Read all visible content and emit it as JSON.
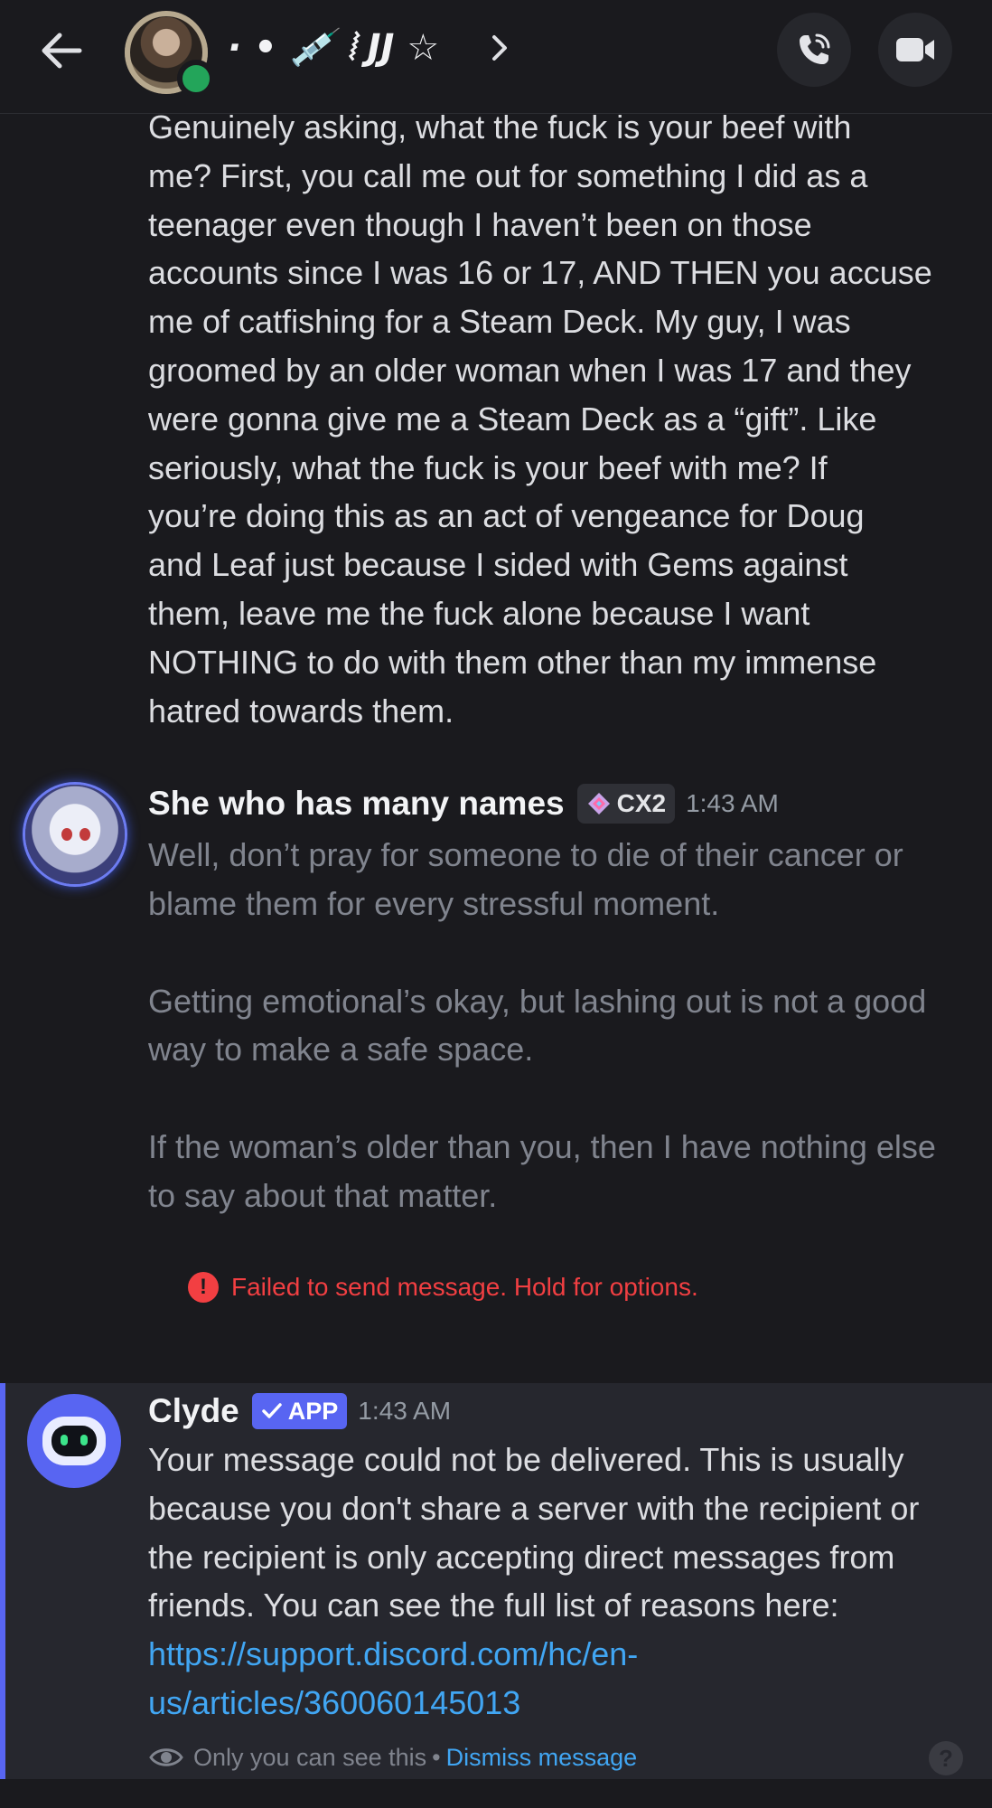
{
  "header": {
    "title": "· • 💉 ⦚ JJ ☆",
    "online": true
  },
  "messages": [
    {
      "body": "Genuinely asking, what the fuck is your beef with\nme? First, you call me out for something I did as a\nteenager even though I haven’t been on those\naccounts since I was 16 or 17, AND THEN you accuse\nme of catfishing for a Steam Deck. My guy, I was\ngroomed by an older woman when I was 17 and they\nwere gonna give me a Steam Deck as a “gift”. Like\nseriously, what the fuck is your beef with me? If\nyou’re doing this as an act of vengeance for Doug\nand Leaf just because I sided with Gems against\nthem, leave me the fuck alone because I want\nNOTHING to do with them other than my immense\nhatred towards them."
    },
    {
      "author": "She who has many names",
      "tag": "CX2",
      "timestamp": "1:43 AM",
      "paragraphs": [
        "Well, don’t pray for someone to die of their cancer or blame them for every stressful moment.",
        "Getting emotional’s okay, but lashing out is not a good way to make a safe space.",
        "If the woman’s older than you, then I have nothing else to say about that matter."
      ],
      "failed_notice": "Failed to send message. Hold for options."
    }
  ],
  "clyde": {
    "author": "Clyde",
    "badge": "APP",
    "timestamp": "1:43 AM",
    "body": "Your message could not be delivered. This is usually because you don't share a server with the recipient or the recipient is only accepting direct messages from friends. You can see the full list of reasons here: ",
    "link": "https://support.discord.com/hc/en-us/articles/360060145013",
    "footer_note": "Only you can see this",
    "dismiss_label": "Dismiss message",
    "help_label": "?"
  },
  "colors": {
    "background": "#1a1a1e",
    "blurple": "#5865f2",
    "link": "#41a6f3",
    "error": "#f23f42",
    "online": "#23a55a"
  },
  "icons": [
    "back-arrow-icon",
    "phone-call-icon",
    "video-camera-icon",
    "chevron-right-icon",
    "alert-icon",
    "eye-icon",
    "checkmark-icon",
    "clyde-bot-icon",
    "guild-tag-icon"
  ]
}
